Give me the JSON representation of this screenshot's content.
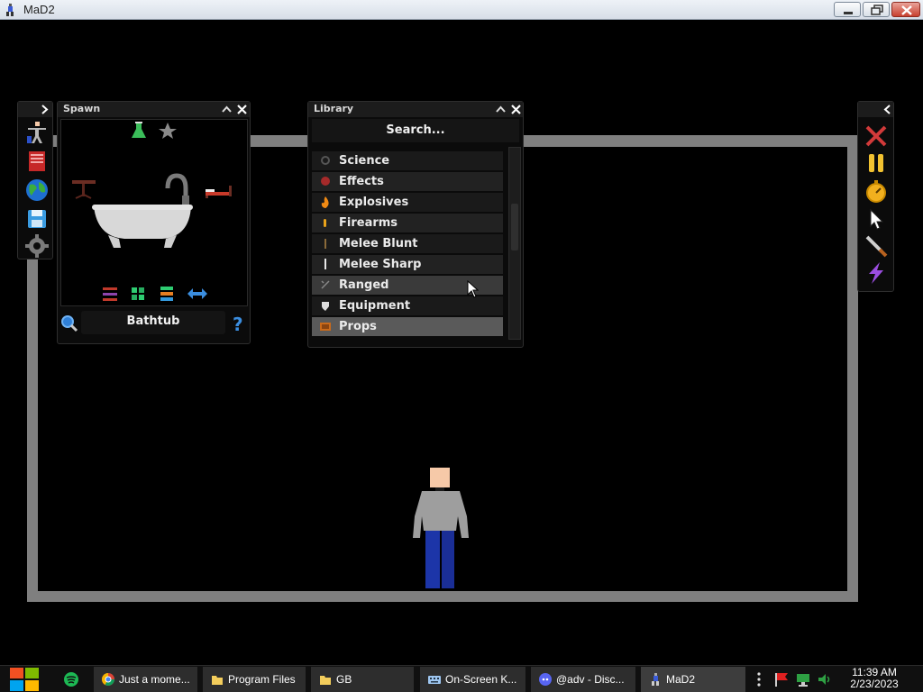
{
  "window": {
    "title": "MaD2"
  },
  "spawn": {
    "title": "Spawn",
    "selected_item": "Bathtub"
  },
  "library": {
    "title": "Library",
    "search_placeholder": "Search...",
    "items": [
      {
        "label": "Science",
        "icon": "science-icon",
        "state": "normal"
      },
      {
        "label": "Effects",
        "icon": "effects-icon",
        "state": "alt"
      },
      {
        "label": "Explosives",
        "icon": "fire-icon",
        "state": "normal"
      },
      {
        "label": "Firearms",
        "icon": "bullet-icon",
        "state": "alt"
      },
      {
        "label": "Melee Blunt",
        "icon": "blunt-icon",
        "state": "normal"
      },
      {
        "label": "Melee Sharp",
        "icon": "blade-icon",
        "state": "alt"
      },
      {
        "label": "Ranged",
        "icon": "ranged-icon",
        "state": "hover"
      },
      {
        "label": "Equipment",
        "icon": "shield-icon",
        "state": "normal"
      },
      {
        "label": "Props",
        "icon": "crate-icon",
        "state": "selected"
      }
    ]
  },
  "taskbar": {
    "items": [
      {
        "label": "Just a mome...",
        "icon": "chrome-icon"
      },
      {
        "label": "Program Files",
        "icon": "folder-icon"
      },
      {
        "label": "GB",
        "icon": "folder-icon"
      },
      {
        "label": "On-Screen K...",
        "icon": "keyboard-icon"
      },
      {
        "label": "@adv - Disc...",
        "icon": "discord-icon"
      },
      {
        "label": "MaD2",
        "icon": "mad2-icon"
      }
    ],
    "clock_time": "11:39 AM",
    "clock_date": "2/23/2023"
  },
  "colors": {
    "room_wall": "#7f7f7f",
    "shirt": "#9e9e9e",
    "pants": "#1c35a8",
    "skin": "#f6c9a8",
    "close_red": "#d23a3a"
  }
}
